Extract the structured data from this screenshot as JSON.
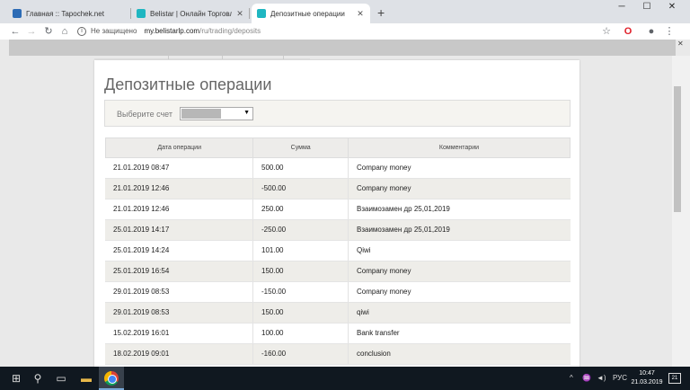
{
  "browser": {
    "tabs": [
      {
        "title": "Главная :: Tapochek.net",
        "fav_color": "#2c6bb5",
        "active": false
      },
      {
        "title": "Belistar | Онлайн Торговля | Бизнес",
        "fav_color": "#1fb6c1",
        "active": false
      },
      {
        "title": "Депозитные операции",
        "fav_color": "#1fb6c1",
        "active": true
      }
    ],
    "new_tab": "+",
    "controls": {
      "minimize": "─",
      "maximize": "☐",
      "close": "✕"
    },
    "nav": {
      "back": "←",
      "forward": "→",
      "reload": "↻",
      "home": "⌂"
    },
    "address": {
      "security": "Не защищено",
      "host": "my.belistarlp.com",
      "path": "/ru/trading/deposits"
    },
    "toolbar_icons": {
      "star": "☆",
      "opera": "O",
      "account": "●",
      "menu": "⋮"
    },
    "bookmarks_close": "✕"
  },
  "page": {
    "heading": "Депозитные операции",
    "filter": {
      "label": "Выберите счет",
      "arrow": "▼"
    },
    "table": {
      "headers": [
        "Дата операции",
        "Сумма",
        "Комментарии"
      ],
      "rows": [
        {
          "date": "21.01.2019 08:47",
          "amount": "500.00",
          "comment": "Company money"
        },
        {
          "date": "21.01.2019 12:46",
          "amount": "-500.00",
          "comment": "Company money"
        },
        {
          "date": "21.01.2019 12:46",
          "amount": "250.00",
          "comment": "Взаимозамен др 25,01,2019"
        },
        {
          "date": "25.01.2019 14:17",
          "amount": "-250.00",
          "comment": "Взаимозамен др 25,01,2019"
        },
        {
          "date": "25.01.2019 14:24",
          "amount": "101.00",
          "comment": "Qiwi"
        },
        {
          "date": "25.01.2019 16:54",
          "amount": "150.00",
          "comment": "Company money"
        },
        {
          "date": "29.01.2019 08:53",
          "amount": "-150.00",
          "comment": "Company money"
        },
        {
          "date": "29.01.2019 08:53",
          "amount": "150.00",
          "comment": "qiwi"
        },
        {
          "date": "15.02.2019 16:01",
          "amount": "100.00",
          "comment": "Bank transfer"
        },
        {
          "date": "18.02.2019 09:01",
          "amount": "-160.00",
          "comment": "conclusion"
        }
      ]
    }
  },
  "taskbar": {
    "start": "⊞",
    "search": "⚲",
    "task_view": "▭",
    "explorer": "▬",
    "tray_arrow": "^",
    "network": "♒",
    "volume": "◄)",
    "lang": "РУС",
    "time": "10:47",
    "date": "21.03.2019",
    "notifications": "21"
  }
}
